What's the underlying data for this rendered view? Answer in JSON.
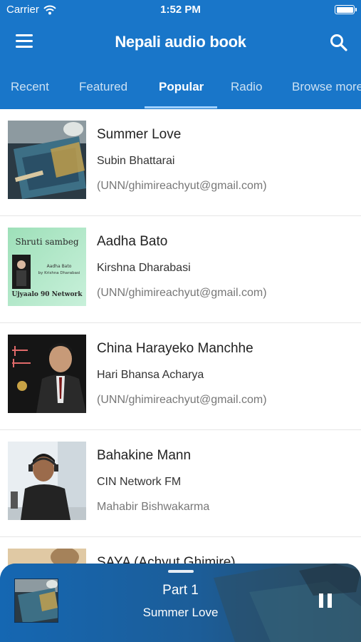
{
  "status_bar": {
    "carrier": "Carrier",
    "time": "1:52 PM"
  },
  "header": {
    "title": "Nepali audio book",
    "menu_icon": "hamburger-menu-icon",
    "search_icon": "search-icon"
  },
  "tabs": [
    {
      "label": "Recent"
    },
    {
      "label": "Featured"
    },
    {
      "label": "Popular",
      "active": true
    },
    {
      "label": "Radio"
    },
    {
      "label": "Browse more"
    }
  ],
  "books": [
    {
      "title": "Summer Love",
      "author": "Subin Bhattarai",
      "publisher": "(UNN/ghimireachyut@gmail.com)"
    },
    {
      "title": "Aadha Bato",
      "author": "Kirshna Dharabasi",
      "publisher": "(UNN/ghimireachyut@gmail.com)",
      "cover_text": {
        "top": "Shruti sambeg",
        "middle": "Aadha Bato",
        "byline": "by Krishna Dharabasi",
        "bottom": "Ujyaalo 90 Network"
      }
    },
    {
      "title": "China Harayeko Manchhe",
      "author": "Hari Bhansa Acharya",
      "publisher": "(UNN/ghimireachyut@gmail.com)"
    },
    {
      "title": "Bahakine Mann",
      "author": "CIN Network FM",
      "publisher": "Mahabir Bishwakarma"
    },
    {
      "title": "SAYA (Achyut Ghimire)"
    }
  ],
  "now_playing": {
    "part": "Part 1",
    "title": "Summer Love",
    "pause_icon": "pause-icon"
  },
  "colors": {
    "app_bar": "#1976c9",
    "tab_indicator": "#9fd0ff",
    "player": "#1d5f9a"
  }
}
